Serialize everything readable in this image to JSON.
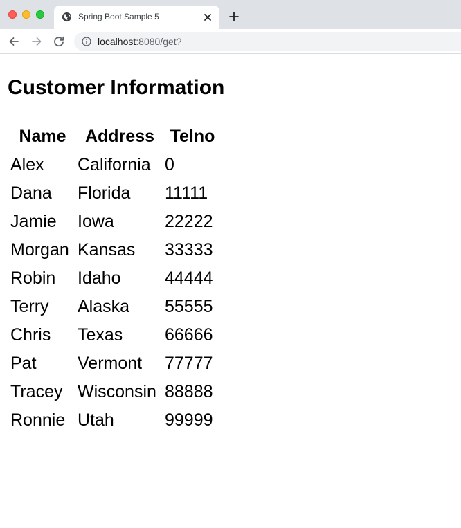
{
  "browser": {
    "tab": {
      "title": "Spring Boot Sample 5"
    },
    "url": {
      "host": "localhost",
      "rest": ":8080/get?"
    }
  },
  "page": {
    "title": "Customer Information",
    "table": {
      "headers": {
        "name": "Name",
        "address": "Address",
        "telno": "Telno"
      },
      "rows": [
        {
          "name": "Alex",
          "address": "California",
          "telno": "0"
        },
        {
          "name": "Dana",
          "address": "Florida",
          "telno": "11111"
        },
        {
          "name": "Jamie",
          "address": "Iowa",
          "telno": "22222"
        },
        {
          "name": "Morgan",
          "address": "Kansas",
          "telno": "33333"
        },
        {
          "name": "Robin",
          "address": "Idaho",
          "telno": "44444"
        },
        {
          "name": "Terry",
          "address": "Alaska",
          "telno": "55555"
        },
        {
          "name": "Chris",
          "address": "Texas",
          "telno": "66666"
        },
        {
          "name": "Pat",
          "address": "Vermont",
          "telno": "77777"
        },
        {
          "name": "Tracey",
          "address": "Wisconsin",
          "telno": "88888"
        },
        {
          "name": "Ronnie",
          "address": "Utah",
          "telno": "99999"
        }
      ]
    }
  },
  "icons": {
    "close_window": "close-window-icon",
    "minimize_window": "minimize-window-icon",
    "zoom_window": "zoom-window-icon",
    "favicon": "globe-icon",
    "tab_close": "close-icon",
    "new_tab": "plus-icon",
    "back": "arrow-left-icon",
    "forward": "arrow-right-icon",
    "reload": "reload-icon",
    "site_info": "info-icon"
  },
  "colors": {
    "tabstrip": "#dee1e6",
    "omnibox": "#f1f3f4",
    "traffic_close": "#ff5f57",
    "traffic_minimize": "#febc2e",
    "traffic_zoom": "#28c840"
  }
}
